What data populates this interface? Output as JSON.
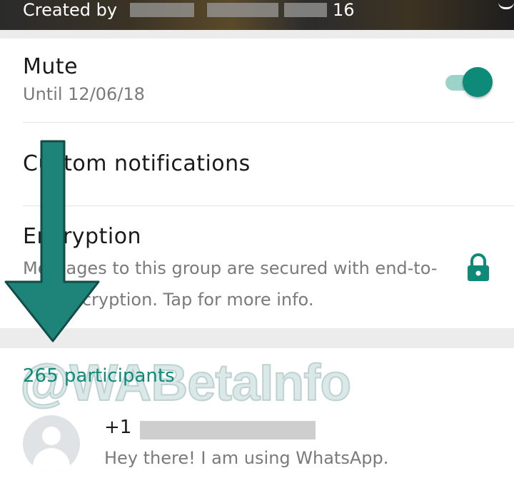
{
  "header": {
    "created_by_label": "Created by",
    "created_suffix": "16"
  },
  "settings": {
    "mute": {
      "title": "Mute",
      "subtitle": "Until 12/06/18",
      "toggle_on": true,
      "toggle_color": "#0e8a78"
    },
    "custom_notifications": {
      "title": "Custom notifications"
    },
    "encryption": {
      "title": "Encryption",
      "description": "Messages to this group are secured with end-to-end encryption. Tap for more info.",
      "icon": "lock-icon"
    }
  },
  "participants": {
    "count_label": "265 participants",
    "items": [
      {
        "name": "+1",
        "status": "Hey there! I am using WhatsApp."
      }
    ]
  },
  "watermark": {
    "text": "@WABetaInfo"
  },
  "colors": {
    "accent": "#0e8a78",
    "arrow": "#1e8479"
  }
}
